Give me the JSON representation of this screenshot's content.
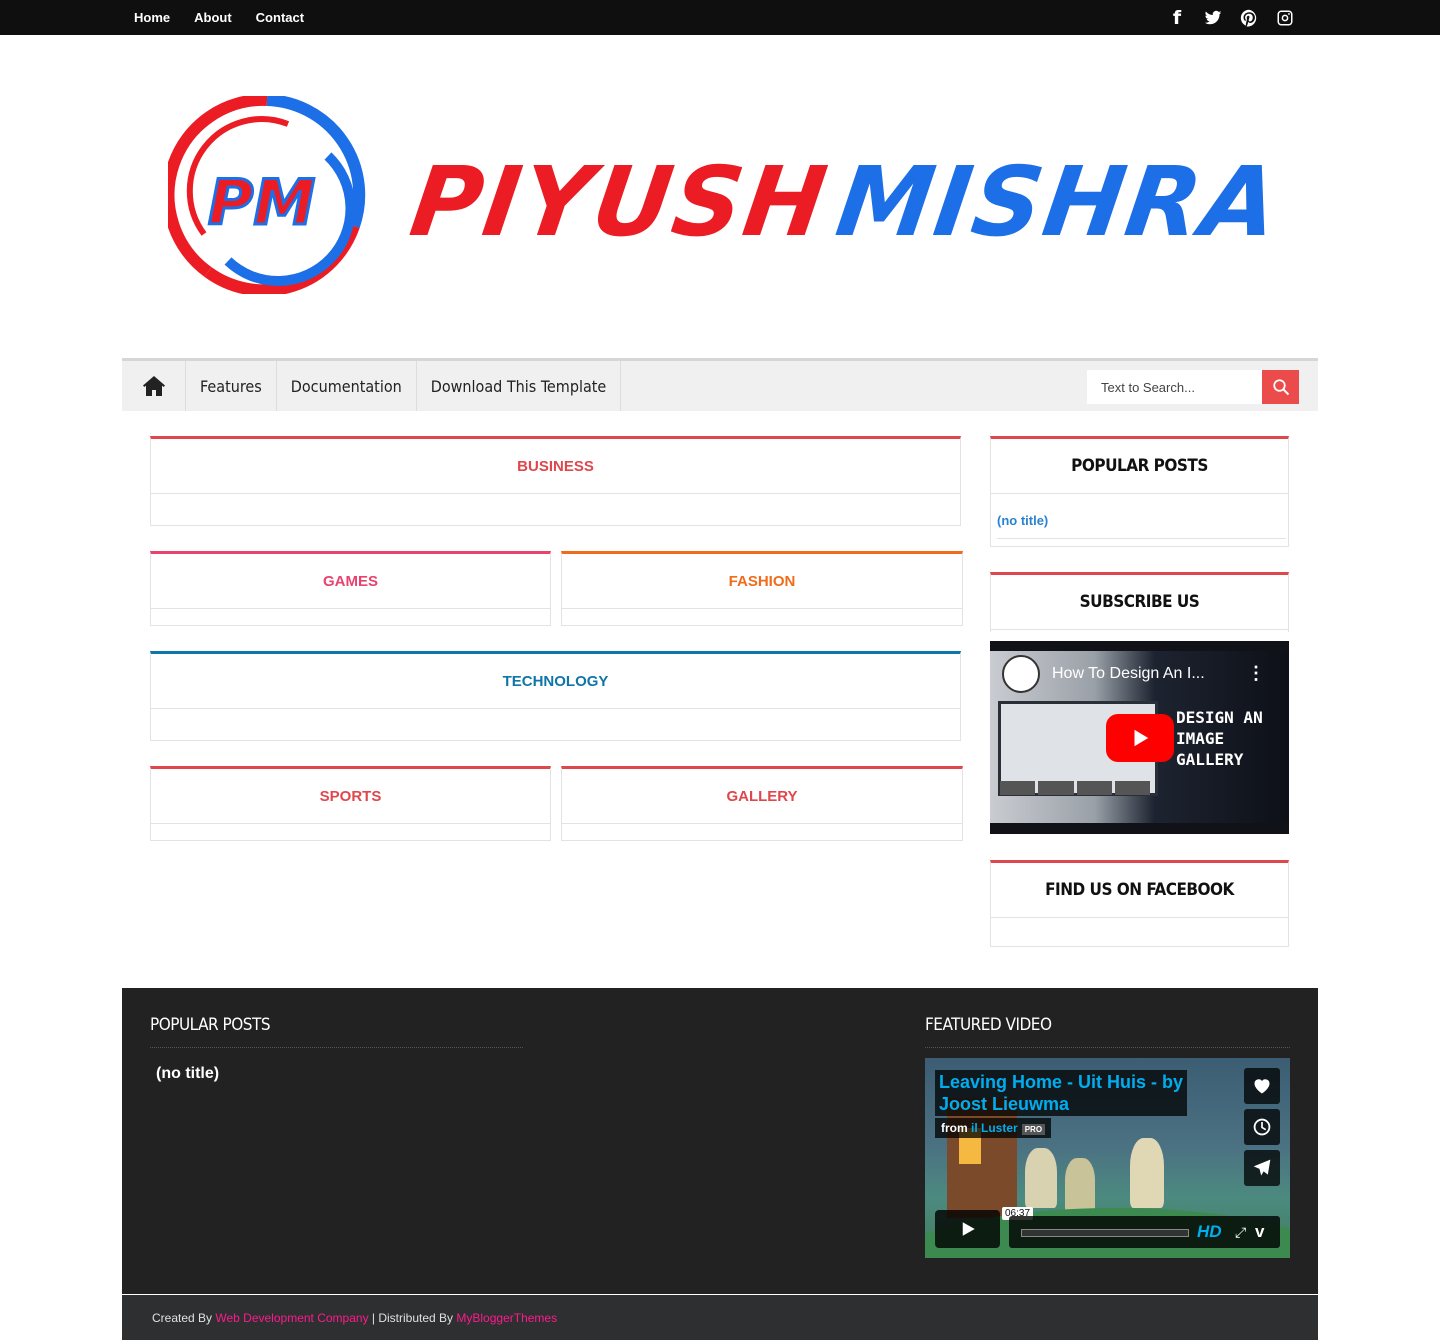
{
  "topbar": {
    "links": [
      "Home",
      "About",
      "Contact"
    ],
    "social_icons": [
      "facebook-icon",
      "twitter-icon",
      "pinterest-icon",
      "instagram-icon"
    ]
  },
  "logo": {
    "monogram": "PM",
    "word1": "PIYUSH",
    "word2": "MISHRA",
    "colors": {
      "red": "#ec1c24",
      "blue": "#1c6fe6"
    }
  },
  "mainnav": {
    "home_icon": "home-icon",
    "items": [
      "Features",
      "Documentation",
      "Download This Template"
    ],
    "search_placeholder": "Text to Search..."
  },
  "sections": {
    "business": {
      "title": "BUSINESS",
      "color": "#e0474c"
    },
    "games": {
      "title": "GAMES",
      "color": "#e8436f"
    },
    "fashion": {
      "title": "FASHION",
      "color": "#ef6c1a"
    },
    "technology": {
      "title": "TECHNOLOGY",
      "color": "#0f76a8"
    },
    "sports": {
      "title": "SPORTS",
      "color": "#e0474c"
    },
    "gallery": {
      "title": "GALLERY",
      "color": "#e0474c"
    }
  },
  "sidebar": {
    "popular": {
      "title": "POPULAR POSTS",
      "link": "(no title)"
    },
    "subscribe": {
      "title": "SUBSCRIBE US",
      "video_title": "How To Design An I...",
      "video_overlay": [
        "DESIGN AN",
        "IMAGE",
        "GALLERY"
      ]
    },
    "facebook": {
      "title": "FIND US ON FACEBOOK"
    }
  },
  "footer": {
    "popular": {
      "title": "POPULAR POSTS",
      "link": "(no title)"
    },
    "featured": {
      "title": "FEATURED VIDEO",
      "video_title_1": "Leaving Home - Uit Huis - by",
      "video_title_2": "Joost Lieuwma",
      "from_label": "from",
      "from_name": "il Luster",
      "pro": "PRO",
      "time": "06:37",
      "hd": "HD"
    }
  },
  "credit": {
    "created_by": "Created By ",
    "link1": "Web Development Company",
    "middle": " | Distributed By ",
    "link2": "MyBloggerThemes"
  }
}
